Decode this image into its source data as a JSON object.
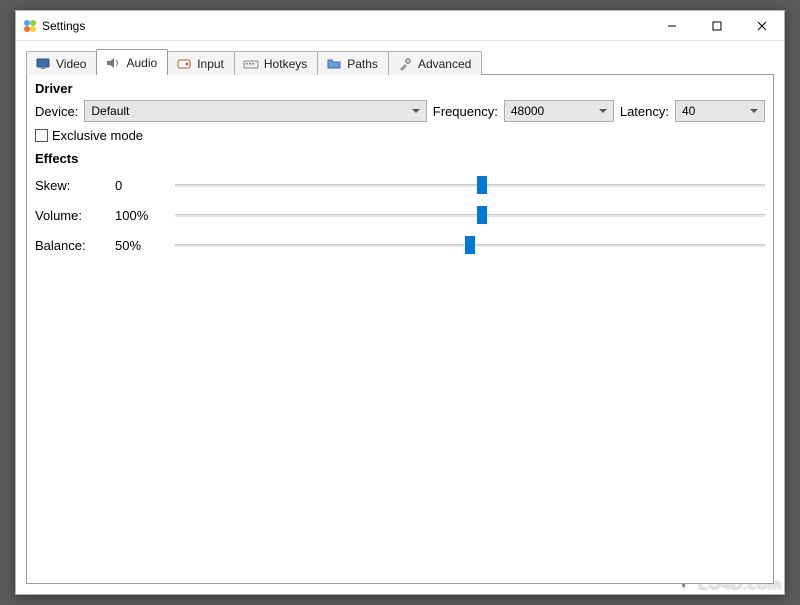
{
  "window": {
    "title": "Settings"
  },
  "tabs": [
    {
      "label": "Video"
    },
    {
      "label": "Audio"
    },
    {
      "label": "Input"
    },
    {
      "label": "Hotkeys"
    },
    {
      "label": "Paths"
    },
    {
      "label": "Advanced"
    }
  ],
  "active_tab": 1,
  "driver": {
    "section_label": "Driver",
    "device_label": "Device:",
    "device_value": "Default",
    "frequency_label": "Frequency:",
    "frequency_value": "48000",
    "latency_label": "Latency:",
    "latency_value": "40",
    "exclusive_label": "Exclusive mode",
    "exclusive_checked": false
  },
  "effects": {
    "section_label": "Effects",
    "skew": {
      "label": "Skew:",
      "value": "0",
      "percent": 52
    },
    "volume": {
      "label": "Volume:",
      "value": "100%",
      "percent": 52
    },
    "balance": {
      "label": "Balance:",
      "value": "50%",
      "percent": 50
    }
  },
  "watermark": "LO4D.com"
}
